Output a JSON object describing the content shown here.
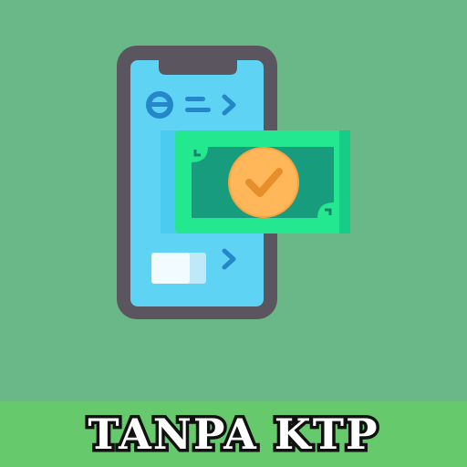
{
  "banner": {
    "text": "TANPA KTP"
  },
  "colors": {
    "background": "#6ab887",
    "banner": "#66c96c",
    "phone_frame": "#5b5560",
    "phone_screen": "#5fd3f3",
    "cash": "#23e88f",
    "cash_inner": "#189c7e",
    "coin": "#ffb75a",
    "check": "#e68e2c"
  },
  "icons": {
    "phone": "smartphone-icon",
    "wallet_logo": "e-wallet-logo-icon",
    "money": "banknote-icon",
    "check": "checkmark-icon"
  }
}
